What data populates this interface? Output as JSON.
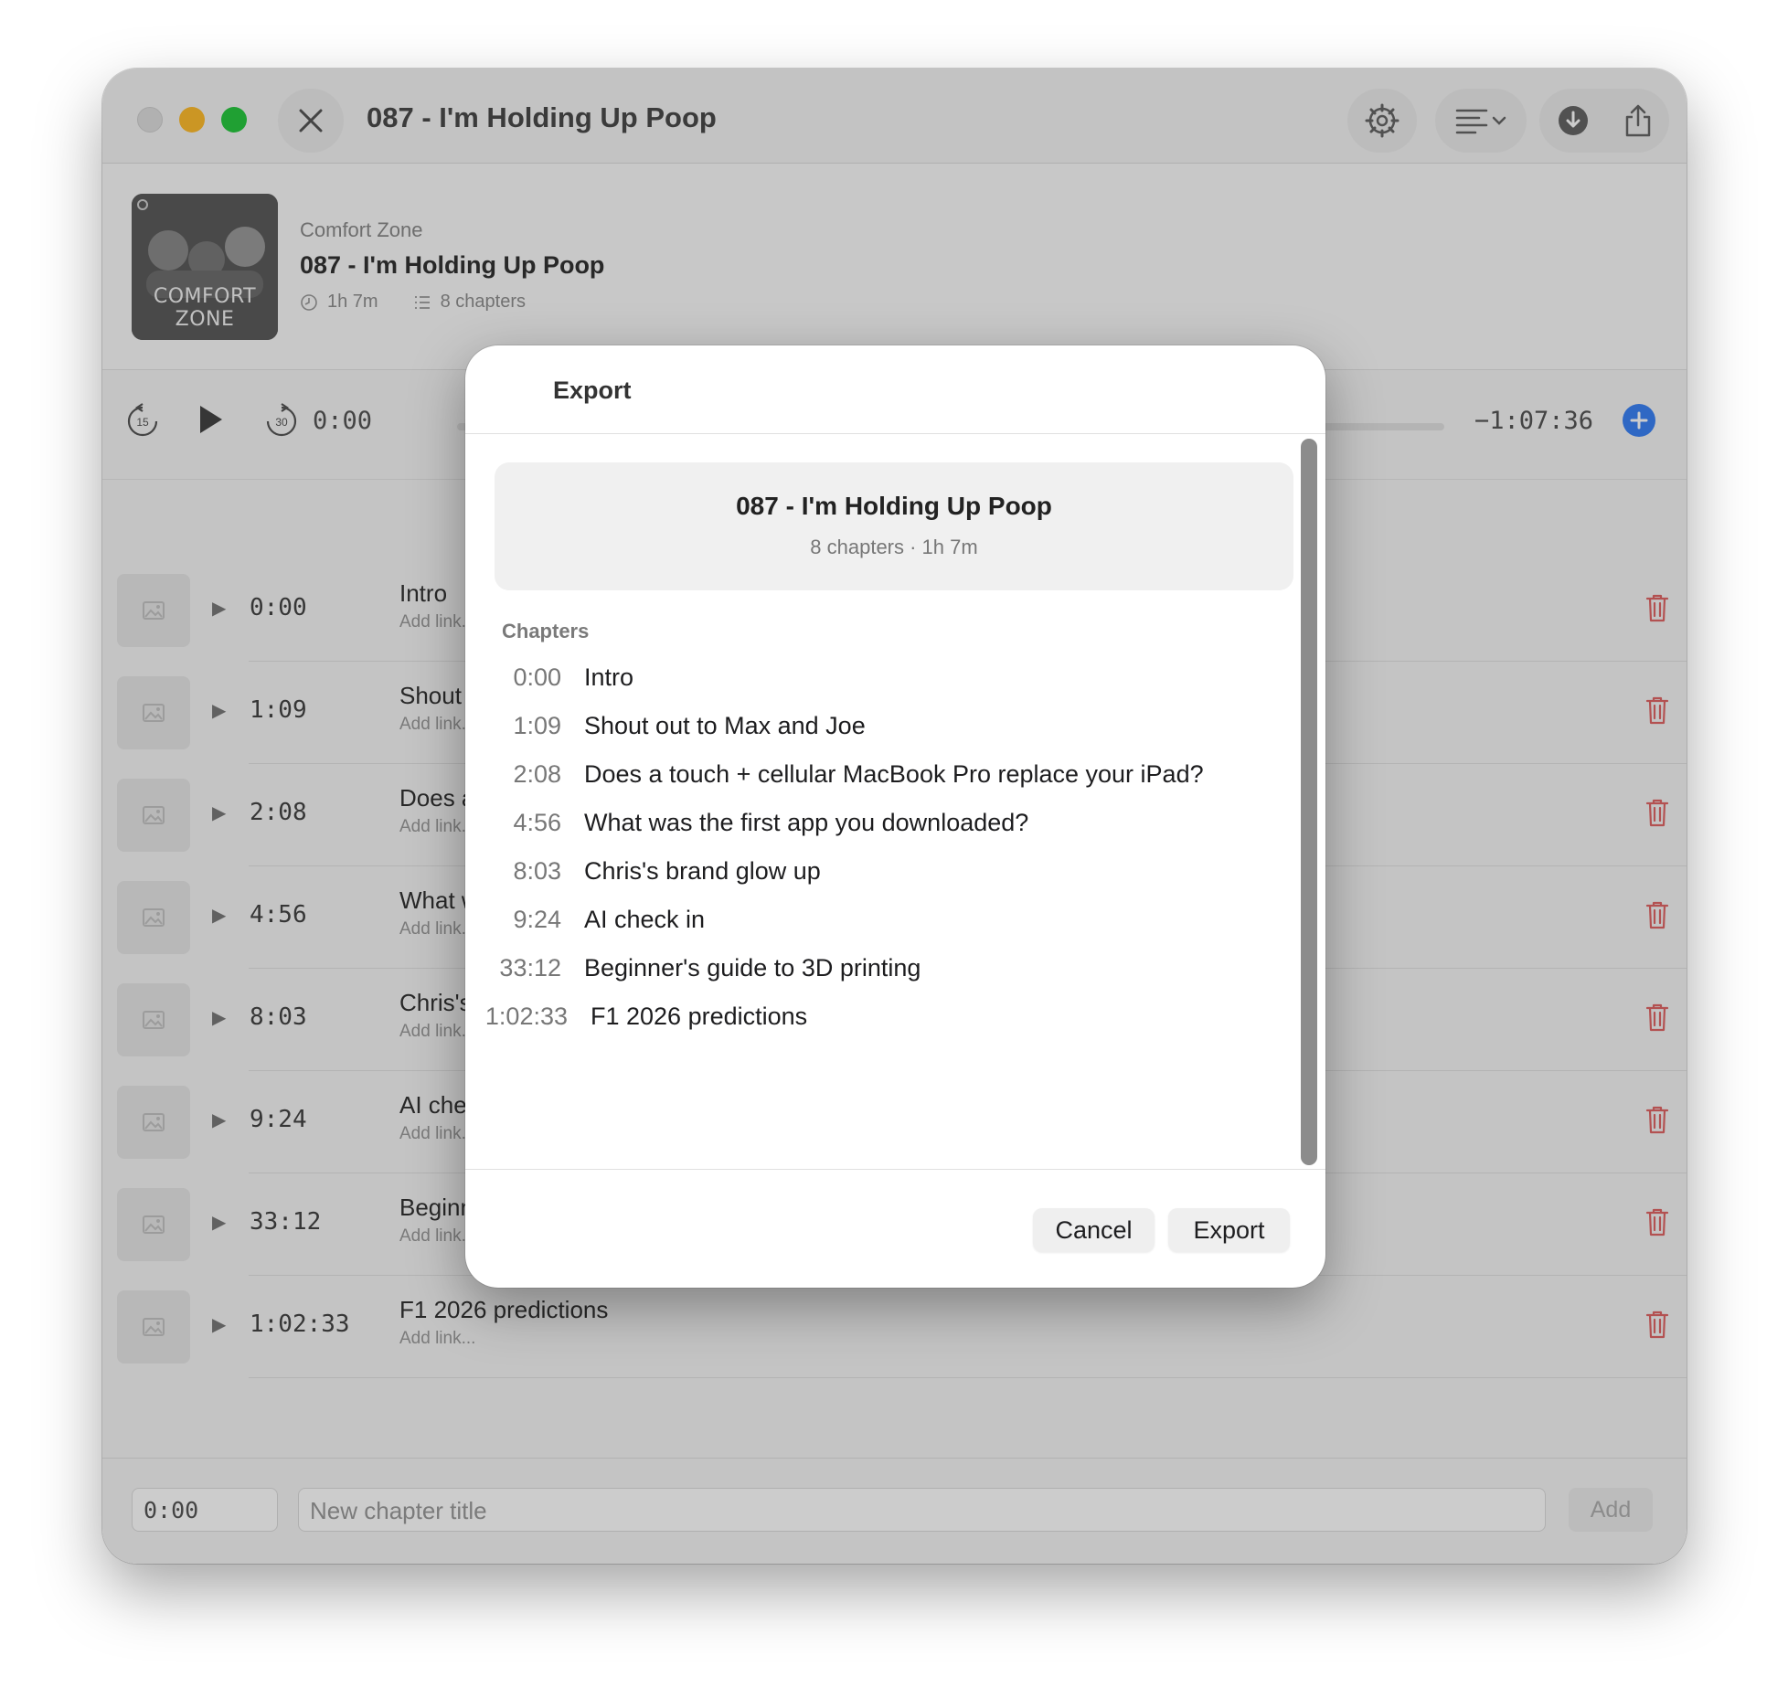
{
  "window": {
    "title": "087 - I'm Holding Up Poop"
  },
  "episode": {
    "podcast": "Comfort Zone",
    "title": "087 - I'm Holding Up Poop",
    "duration": "1h 7m",
    "chapter_count": "8 chapters",
    "cover_text": "COMFORT ZONE"
  },
  "transport": {
    "skip_back": "15",
    "skip_forward": "30",
    "current_time": "0:00",
    "remaining_time": "−1:07:36"
  },
  "chapters": [
    {
      "time": "0:00",
      "title": "Intro",
      "link": "Add link..."
    },
    {
      "time": "1:09",
      "title": "Shout out to Max and Joe",
      "link": "Add link..."
    },
    {
      "time": "2:08",
      "title": "Does a touch + cellular MacBook Pro replace your iPad?",
      "link": "Add link..."
    },
    {
      "time": "4:56",
      "title": "What was the first app you downloaded?",
      "link": "Add link..."
    },
    {
      "time": "8:03",
      "title": "Chris's brand glow up",
      "link": "Add link..."
    },
    {
      "time": "9:24",
      "title": "AI check in",
      "link": "Add link..."
    },
    {
      "time": "33:12",
      "title": "Beginner's guide to 3D printing",
      "link": "Add link..."
    },
    {
      "time": "1:02:33",
      "title": "F1 2026 predictions",
      "link": "Add link..."
    }
  ],
  "add_bar": {
    "time_value": "0:00",
    "title_placeholder": "New chapter title",
    "add_label": "Add"
  },
  "export_sheet": {
    "title": "Export",
    "summary_title": "087 - I'm Holding Up Poop",
    "summary_subtitle": "8 chapters · 1h 7m",
    "section_label": "Chapters",
    "cancel_label": "Cancel",
    "export_label": "Export"
  },
  "colors": {
    "accent": "#3b82f6",
    "trash": "#e06666",
    "traffic_min": "#febc2e",
    "traffic_max": "#28c840"
  }
}
